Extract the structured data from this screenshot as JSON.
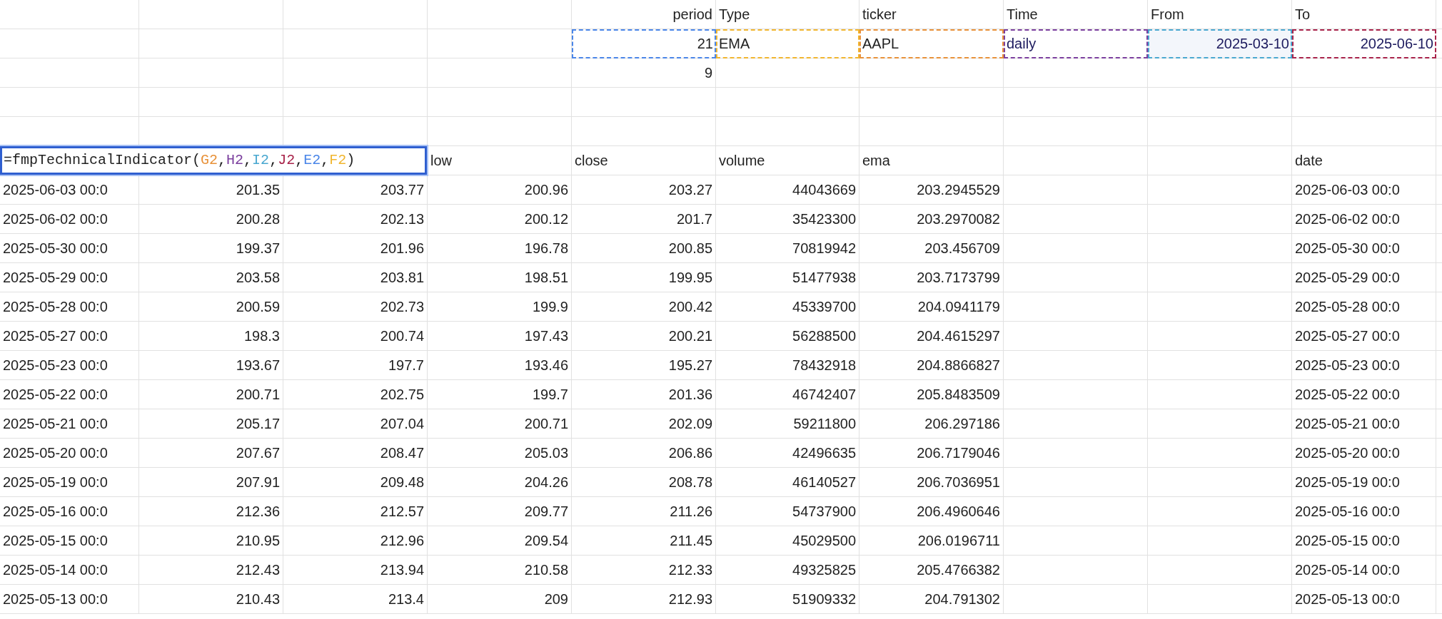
{
  "top_labels": [
    "period",
    "Type",
    "ticker",
    "Time",
    "From",
    "To"
  ],
  "parameters": [
    {
      "text": "21",
      "kind": "number",
      "color": "#4a86e8",
      "highlighted": false
    },
    {
      "text": "EMA",
      "kind": "text",
      "color": "#f1b630",
      "highlighted": false
    },
    {
      "text": "AAPL",
      "kind": "text",
      "color": "#e8923a",
      "highlighted": false
    },
    {
      "text": "daily",
      "kind": "choice",
      "color": "#7b3f9e",
      "highlighted": false
    },
    {
      "text": "2025-03-10",
      "kind": "date",
      "color": "#4aa8d0",
      "highlighted": true
    },
    {
      "text": "2025-06-10",
      "kind": "date",
      "color": "#a8234a",
      "highlighted": false
    }
  ],
  "extra_period": "9",
  "formula": {
    "active": true,
    "parts": [
      {
        "text": "=fmpTechnicalIndicator(",
        "color": "#1f1f1f"
      },
      {
        "text": "G2",
        "color": "#e8923a"
      },
      {
        "text": ",",
        "color": "#1f1f1f"
      },
      {
        "text": "H2",
        "color": "#7b3f9e"
      },
      {
        "text": ",",
        "color": "#1f1f1f"
      },
      {
        "text": "I2",
        "color": "#4aa8d0"
      },
      {
        "text": ",",
        "color": "#1f1f1f"
      },
      {
        "text": "J2",
        "color": "#a8234a"
      },
      {
        "text": ",",
        "color": "#1f1f1f"
      },
      {
        "text": "E2",
        "color": "#4a86e8"
      },
      {
        "text": ",",
        "color": "#1f1f1f"
      },
      {
        "text": "F2",
        "color": "#f1b630"
      },
      {
        "text": ")",
        "color": "#1f1f1f"
      }
    ]
  },
  "column_headers": [
    "low",
    "close",
    "volume",
    "ema"
  ],
  "date_header": "date",
  "rows": [
    [
      "2025-06-03 00:0",
      "201.35",
      "203.77",
      "200.96",
      "203.27",
      "44043669",
      "203.2945529",
      "2025-06-03 00:0"
    ],
    [
      "2025-06-02 00:0",
      "200.28",
      "202.13",
      "200.12",
      "201.7",
      "35423300",
      "203.2970082",
      "2025-06-02 00:0"
    ],
    [
      "2025-05-30 00:0",
      "199.37",
      "201.96",
      "196.78",
      "200.85",
      "70819942",
      "203.456709",
      "2025-05-30 00:0"
    ],
    [
      "2025-05-29 00:0",
      "203.58",
      "203.81",
      "198.51",
      "199.95",
      "51477938",
      "203.7173799",
      "2025-05-29 00:0"
    ],
    [
      "2025-05-28 00:0",
      "200.59",
      "202.73",
      "199.9",
      "200.42",
      "45339700",
      "204.0941179",
      "2025-05-28 00:0"
    ],
    [
      "2025-05-27 00:0",
      "198.3",
      "200.74",
      "197.43",
      "200.21",
      "56288500",
      "204.4615297",
      "2025-05-27 00:0"
    ],
    [
      "2025-05-23 00:0",
      "193.67",
      "197.7",
      "193.46",
      "195.27",
      "78432918",
      "204.8866827",
      "2025-05-23 00:0"
    ],
    [
      "2025-05-22 00:0",
      "200.71",
      "202.75",
      "199.7",
      "201.36",
      "46742407",
      "205.8483509",
      "2025-05-22 00:0"
    ],
    [
      "2025-05-21 00:0",
      "205.17",
      "207.04",
      "200.71",
      "202.09",
      "59211800",
      "206.297186",
      "2025-05-21 00:0"
    ],
    [
      "2025-05-20 00:0",
      "207.67",
      "208.47",
      "205.03",
      "206.86",
      "42496635",
      "206.7179046",
      "2025-05-20 00:0"
    ],
    [
      "2025-05-19 00:0",
      "207.91",
      "209.48",
      "204.26",
      "208.78",
      "46140527",
      "206.7036951",
      "2025-05-19 00:0"
    ],
    [
      "2025-05-16 00:0",
      "212.36",
      "212.57",
      "209.77",
      "211.26",
      "54737900",
      "206.4960646",
      "2025-05-16 00:0"
    ],
    [
      "2025-05-15 00:0",
      "210.95",
      "212.96",
      "209.54",
      "211.45",
      "45029500",
      "206.0196711",
      "2025-05-15 00:0"
    ],
    [
      "2025-05-14 00:0",
      "212.43",
      "213.94",
      "210.58",
      "212.33",
      "49325825",
      "205.4766382",
      "2025-05-14 00:0"
    ],
    [
      "2025-05-13 00:0",
      "210.43",
      "213.4",
      "209",
      "212.93",
      "51909332",
      "204.791302",
      "2025-05-13 00:0"
    ]
  ]
}
